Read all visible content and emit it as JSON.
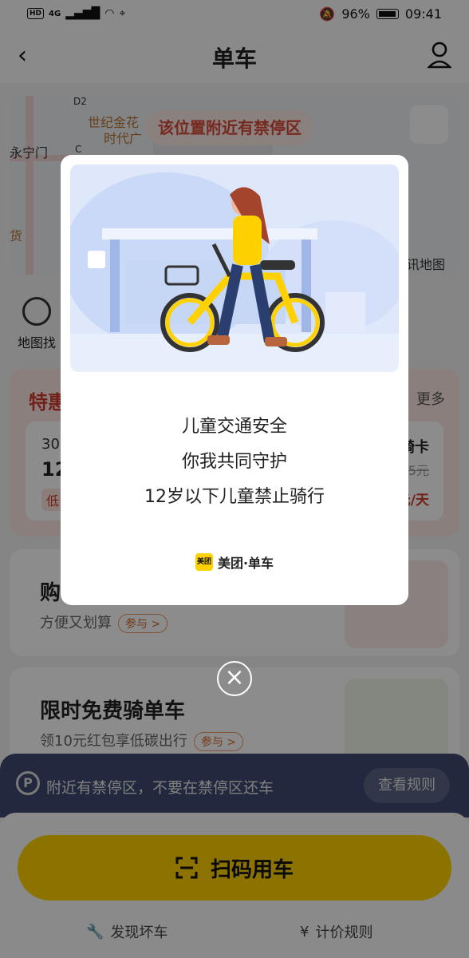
{
  "status_bar": {
    "network": "4G",
    "battery": "96%",
    "time": "09:41"
  },
  "header": {
    "title": "单车"
  },
  "map": {
    "warning": "该位置附近有禁停区",
    "labels": [
      "永宁门",
      "世纪金花",
      "时代广",
      "讯地图",
      "货",
      "D2",
      "C"
    ]
  },
  "shortcut": {
    "label": "地图找"
  },
  "promo": {
    "title": "特惠",
    "more": "更多",
    "left_text_1": "30",
    "left_text_2": "12",
    "left_tag": "低",
    "right_title": "畅骑卡",
    "right_price_old": "35元",
    "right_price_new": "元",
    "right_offer": "0.33元/天"
  },
  "card1": {
    "title": "购",
    "subtitle": "方便又划算",
    "pill": "参与 >"
  },
  "card2": {
    "title": "限时免费骑单车",
    "subtitle": "领10元红包享低碳出行",
    "pill": "参与 >"
  },
  "notice": {
    "text": "附近有禁停区，不要在禁停区还车",
    "button": "查看规则",
    "icon": "P"
  },
  "bottom": {
    "scan": "扫码用车",
    "report": "发现坏车",
    "pricing": "计价规则"
  },
  "modal": {
    "line1": "儿童交通安全",
    "line2": "你我共同守护",
    "line3": "12岁以下儿童禁止骑行",
    "brand": "美团·单车",
    "logo_text": "美团"
  },
  "close": "×"
}
